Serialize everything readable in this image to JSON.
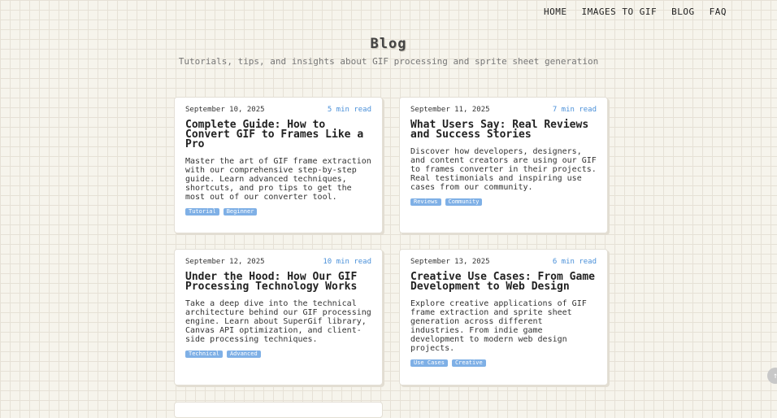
{
  "nav": {
    "items": [
      {
        "label": "HOME"
      },
      {
        "label": "IMAGES TO GIF"
      },
      {
        "label": "BLOG"
      },
      {
        "label": "FAQ"
      }
    ]
  },
  "header": {
    "title": "Blog",
    "subtitle": "Tutorials, tips, and insights about GIF processing and sprite sheet generation"
  },
  "posts": [
    {
      "date": "September 10, 2025",
      "read_time": "5 min read",
      "title": "Complete Guide: How to Convert GIF to Frames Like a Pro",
      "excerpt": "Master the art of GIF frame extraction with our comprehensive step-by-step guide. Learn advanced techniques, shortcuts, and pro tips to get the most out of our converter tool.",
      "tags": [
        "Tutorial",
        "Beginner"
      ]
    },
    {
      "date": "September 11, 2025",
      "read_time": "7 min read",
      "title": "What Users Say: Real Reviews and Success Stories",
      "excerpt": "Discover how developers, designers, and content creators are using our GIF to frames converter in their projects. Real testimonials and inspiring use cases from our community.",
      "tags": [
        "Reviews",
        "Community"
      ]
    },
    {
      "date": "September 12, 2025",
      "read_time": "10 min read",
      "title": "Under the Hood: How Our GIF Processing Technology Works",
      "excerpt": "Take a deep dive into the technical architecture behind our GIF processing engine. Learn about SuperGif library, Canvas API optimization, and client-side processing techniques.",
      "tags": [
        "Technical",
        "Advanced"
      ]
    },
    {
      "date": "September 13, 2025",
      "read_time": "6 min read",
      "title": "Creative Use Cases: From Game Development to Web Design",
      "excerpt": "Explore creative applications of GIF frame extraction and sprite sheet generation across different industries. From indie game development to modern web design projects.",
      "tags": [
        "Use Cases",
        "Creative"
      ]
    }
  ],
  "scroll_top": {
    "icon": "arrow-up-icon",
    "glyph": "↑"
  }
}
